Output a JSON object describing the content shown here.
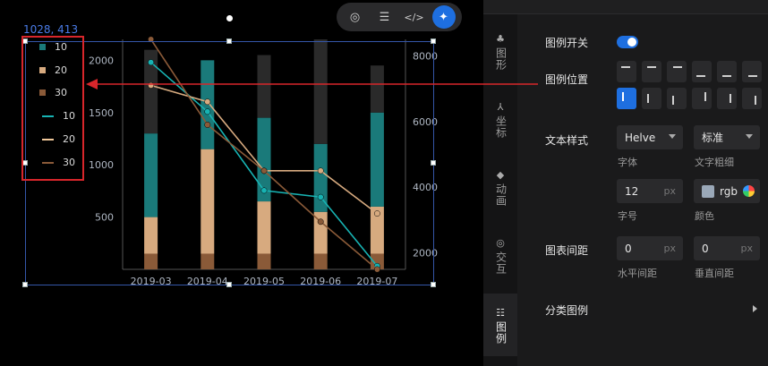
{
  "canvas": {
    "coord_readout": "1028, 413",
    "legend": [
      {
        "label": "10",
        "kind": "bar",
        "color": "#1a7a7a"
      },
      {
        "label": "20",
        "kind": "bar",
        "color": "#d7aa7f"
      },
      {
        "label": "30",
        "kind": "bar",
        "color": "#8a5a38"
      },
      {
        "label": "10",
        "kind": "line",
        "color": "#17b3b3"
      },
      {
        "label": "20",
        "kind": "line",
        "color": "#f0c89a"
      },
      {
        "label": "30",
        "kind": "line",
        "color": "#8a5a38"
      }
    ],
    "toolbar": [
      {
        "name": "interaction-icon",
        "glyph": "◎"
      },
      {
        "name": "settings-sliders-icon",
        "glyph": "☰"
      },
      {
        "name": "code-icon",
        "glyph": "</>"
      },
      {
        "name": "ai-sparkle-icon",
        "glyph": "✦"
      }
    ],
    "accent_color": "#d8262b"
  },
  "chart_data": {
    "type": "bar",
    "categories": [
      "2019-03",
      "2019-04",
      "2019-05",
      "2019-06",
      "2019-07"
    ],
    "left_axis": {
      "ticks": [
        "500",
        "1000",
        "1500",
        "2000"
      ],
      "ylim": [
        0,
        2200
      ]
    },
    "right_axis": {
      "ticks": [
        "2000",
        "4000",
        "6000",
        "8000"
      ],
      "ylim": [
        1500,
        8500
      ]
    },
    "bar_series": [
      {
        "values": [
          150,
          150,
          150,
          150,
          150
        ],
        "color": "#8a5a38"
      },
      {
        "values": [
          350,
          1000,
          500,
          400,
          450
        ],
        "color": "#d7aa7f"
      },
      {
        "values": [
          800,
          850,
          800,
          650,
          900
        ],
        "color": "#1a7a7a"
      },
      {
        "values": [
          800,
          0,
          600,
          1000,
          450
        ],
        "color": "#2a2a2a"
      }
    ],
    "line_series": [
      {
        "values": [
          7800,
          6300,
          3900,
          3700,
          1600
        ],
        "color": "#17b3b3"
      },
      {
        "values": [
          7100,
          6600,
          4500,
          4500,
          3200
        ],
        "color": "#d7aa7f"
      },
      {
        "values": [
          8500,
          5900,
          4500,
          2950,
          1500
        ],
        "color": "#8a5a38"
      }
    ]
  },
  "panel": {
    "sidebar": [
      {
        "name": "sidebar-item-shape",
        "label": "图形",
        "icon": "♣"
      },
      {
        "name": "sidebar-item-axis",
        "label": "坐标",
        "icon": "⅄"
      },
      {
        "name": "sidebar-item-animation",
        "label": "动画",
        "icon": "◆"
      },
      {
        "name": "sidebar-item-interaction",
        "label": "交互",
        "icon": "◎"
      },
      {
        "name": "sidebar-item-legend",
        "label": "图例",
        "icon": "☷"
      }
    ],
    "legend_toggle_label": "图例开关",
    "legend_toggle_on": true,
    "legend_position_label": "图例位置",
    "text_style_label": "文本样式",
    "font_value": "Helve",
    "font_caption": "字体",
    "weight_value": "标准",
    "weight_caption": "文字粗细",
    "font_size_value": "12",
    "font_size_unit": "px",
    "font_size_caption": "字号",
    "color_value": "rgb",
    "color_caption": "颜色",
    "spacing_label": "图表间距",
    "h_spacing_value": "0",
    "h_spacing_unit": "px",
    "h_spacing_caption": "水平间距",
    "v_spacing_value": "0",
    "v_spacing_unit": "px",
    "v_spacing_caption": "垂直间距",
    "category_legend_label": "分类图例"
  }
}
